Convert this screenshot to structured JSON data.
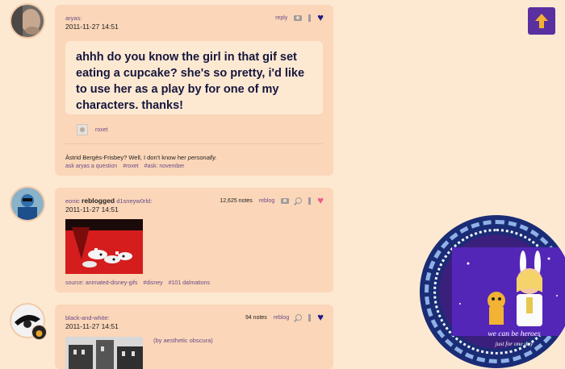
{
  "posts": [
    {
      "username": "aryas",
      "date": "2011-11-27 14:51",
      "actions": {
        "reply": "reply"
      },
      "question": "ahhh do you know the girl in that gif set eating a cupcake? she's so pretty, i'd like to use her as a play by for one of my characters. thanks!",
      "asker": "roxet",
      "answer_prefix": "Àstrid Bergès-Frisbey? Well, I don't know her ",
      "answer_em": "personally.",
      "tags": [
        "ask aryas a question",
        "#roxet",
        "#ask: november"
      ]
    },
    {
      "username": "eonic",
      "reblog_text": "reblogged",
      "reblog_from": "d1sneyw0rld",
      "date": "2011-11-27 14:51",
      "notes": "12,625 notes",
      "actions": {
        "reblog": "reblog"
      },
      "tags": [
        "source: animated-disney-gifs",
        "#disney",
        "#101 dalmations"
      ]
    },
    {
      "username": "black-and-white",
      "date": "2011-11-27 14:51",
      "notes": "94 notes",
      "actions": {
        "reblog": "reblog"
      },
      "caption": "(by aesthetic obscura)"
    }
  ],
  "widget": {
    "caption_line1": "we can be heroes",
    "caption_line2": "just for one day"
  },
  "colors": {
    "background": "#fde9d2",
    "post": "#fbd6b8",
    "link": "#6a4b8a",
    "accent": "#5a2fa0",
    "heart_liked": "#1f1a8a",
    "heart_pink": "#ee5a86"
  },
  "icons": [
    "camera-icon",
    "bookmark-icon",
    "search-icon",
    "heart-icon",
    "arrow-up-icon"
  ]
}
